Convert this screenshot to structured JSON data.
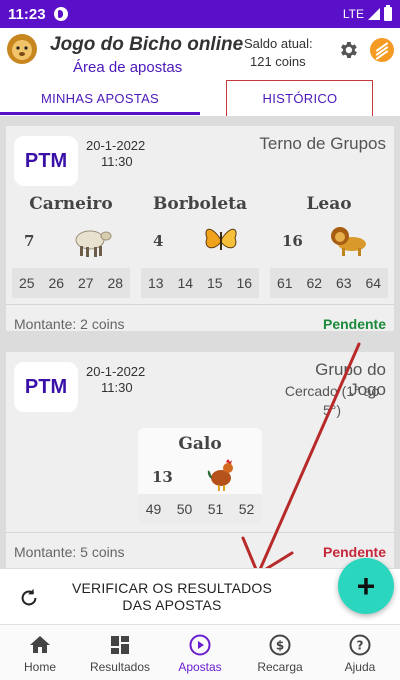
{
  "status_bar": {
    "time": "11:23",
    "network": "LTE"
  },
  "header": {
    "title": "Jogo do Bicho online",
    "subtitle": "Área de apostas",
    "saldo_label": "Saldo atual:",
    "saldo_value": "121 coins"
  },
  "tabs": [
    {
      "label": "MINHAS APOSTAS",
      "active": true
    },
    {
      "label": "HISTÓRICO",
      "active": false
    }
  ],
  "bets": [
    {
      "lottery": "PTM",
      "date": "20-1-2022",
      "time": "11:30",
      "type": "Terno de Grupos",
      "groups": [
        {
          "name": "Carneiro",
          "number": "7",
          "animal": "sheep-icon",
          "numbers": [
            "25",
            "26",
            "27",
            "28"
          ]
        },
        {
          "name": "Borboleta",
          "number": "4",
          "animal": "butterfly-icon",
          "numbers": [
            "13",
            "14",
            "15",
            "16"
          ]
        },
        {
          "name": "Leao",
          "number": "16",
          "animal": "lion-icon",
          "numbers": [
            "61",
            "62",
            "63",
            "64"
          ]
        }
      ],
      "amount": "Montante: 2 coins",
      "status": "Pendente",
      "status_color": "#1b8a3a"
    },
    {
      "lottery": "PTM",
      "date": "20-1-2022",
      "time": "11:30",
      "type": "Grupo do Jogo",
      "type_detail_1": "Cercado (1° ao",
      "type_detail_2": "5°)",
      "groups": [
        {
          "name": "Galo",
          "number": "13",
          "animal": "rooster-icon",
          "numbers": [
            "49",
            "50",
            "51",
            "52"
          ]
        }
      ],
      "amount": "Montante: 5 coins",
      "status": "Pendente",
      "status_color": "#c6283b"
    }
  ],
  "action": {
    "label": "VERIFICAR OS RESULTADOS DAS APOSTAS",
    "fab_label": "+"
  },
  "nav": [
    {
      "label": "Home",
      "icon": "home-icon",
      "active": false
    },
    {
      "label": "Resultados",
      "icon": "grid-icon",
      "active": false
    },
    {
      "label": "Apostas",
      "icon": "play-icon",
      "active": true
    },
    {
      "label": "Recarga",
      "icon": "dollar-icon",
      "active": false
    },
    {
      "label": "Ajuda",
      "icon": "help-icon",
      "active": false
    }
  ],
  "colors": {
    "primary": "#5a0fc8",
    "accent": "#2bd6bf",
    "pending_green": "#1b8a3a",
    "pending_red": "#c6283b",
    "annotation": "#c43a3a"
  }
}
